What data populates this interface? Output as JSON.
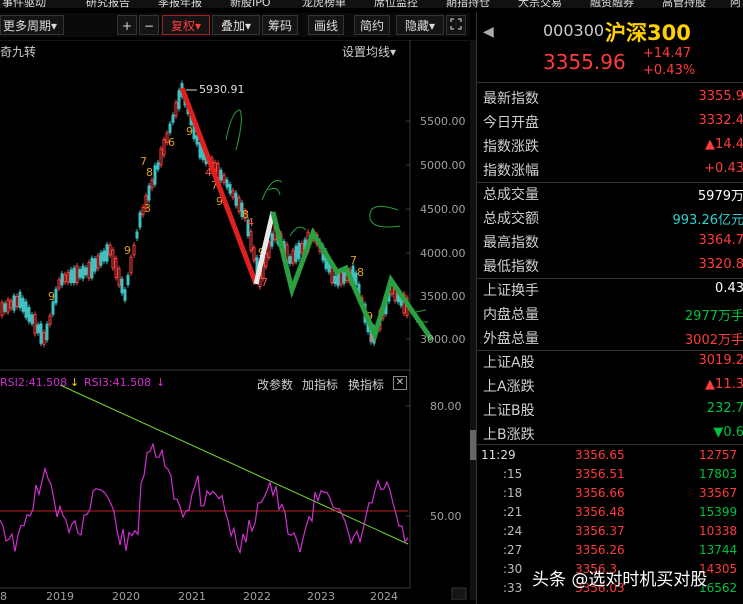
{
  "top_menu": [
    "事件驱动",
    "研究报告",
    "季报年报",
    "新股IPO",
    "龙虎榜单",
    "席位监控",
    "期指持仓",
    "大宗交易",
    "融资融券",
    "高管持股",
    "阿"
  ],
  "toolbar": {
    "period": "更多周期",
    "period_arrow": "▾",
    "plus": "+",
    "minus": "−",
    "adjust": "复权",
    "overlay": "叠加",
    "chips": "筹码",
    "draw": "画线",
    "simple": "简约",
    "hide": "隐藏"
  },
  "main_chart": {
    "indicator_name": "奇九转",
    "set_ma": "设置均线",
    "peak_label": "5930.91",
    "y_ticks": [
      "5500.00",
      "5000.00",
      "4500.00",
      "4000.00",
      "3500.00",
      "3000.00"
    ]
  },
  "rsi_panel": {
    "rsi2": "RSI2:41.508",
    "rsi3": "RSI3:41.508",
    "change_params": "改参数",
    "add_indicator": "加指标",
    "switch_indicator": "换指标",
    "y_ticks": [
      "80.00",
      "50.00"
    ]
  },
  "x_axis": [
    "8",
    "2019",
    "2020",
    "2021",
    "2022",
    "2023",
    "2024"
  ],
  "quote": {
    "code": "000300",
    "name": "沪深300",
    "price": "3355.96",
    "change": "+14.47",
    "change_pct": "+0.43%",
    "colors": {
      "up": "#ff3b3b",
      "down": "#00c040",
      "yellow": "#ffd000",
      "cyan": "#31d0d0"
    }
  },
  "stats": [
    {
      "label": "最新指数",
      "value": "3355.9",
      "color": "#ff3b3b"
    },
    {
      "label": "今日开盘",
      "value": "3332.4",
      "color": "#ff3b3b"
    },
    {
      "label": "指数涨跌",
      "value": "▲14.4",
      "color": "#ff3b3b"
    },
    {
      "label": "指数涨幅",
      "value": "+0.43",
      "color": "#ff3b3b"
    },
    {
      "label": "总成交量",
      "value": "5979万",
      "color": "#ffffff"
    },
    {
      "label": "总成交额",
      "value": "993.26亿元",
      "color": "#31d0d0"
    },
    {
      "label": "最高指数",
      "value": "3364.7",
      "color": "#ff3b3b"
    },
    {
      "label": "最低指数",
      "value": "3320.8",
      "color": "#ff3b3b"
    },
    {
      "label": "上证换手",
      "value": "0.43",
      "color": "#ffffff"
    },
    {
      "label": "内盘总量",
      "value": "2977万手",
      "color": "#00c040"
    },
    {
      "label": "外盘总量",
      "value": "3002万手",
      "color": "#ff3b3b"
    },
    {
      "label": "上证A股",
      "value": "3019.2",
      "color": "#ff3b3b"
    },
    {
      "label": "上A涨跌",
      "value": "▲11.3",
      "color": "#ff3b3b"
    },
    {
      "label": "上证B股",
      "value": "232.7",
      "color": "#00c040"
    },
    {
      "label": "上B涨跌",
      "value": "▼0.6",
      "color": "#00c040"
    }
  ],
  "ticks": [
    {
      "time": "11:29",
      "price": "3356.65",
      "vol": "12757"
    },
    {
      "time": ":15",
      "price": "3356.51",
      "vol": "17803"
    },
    {
      "time": ":18",
      "price": "3356.66",
      "vol": "33567"
    },
    {
      "time": ":21",
      "price": "3356.48",
      "vol": "15399"
    },
    {
      "time": ":24",
      "price": "3356.37",
      "vol": "10338"
    },
    {
      "time": ":27",
      "price": "3356.26",
      "vol": "13744"
    },
    {
      "time": ":30",
      "price": "3356.3",
      "vol": "14305"
    },
    {
      "time": ":33",
      "price": "3356.03",
      "vol": "16562"
    }
  ],
  "watermark": "头条 @选对时机买对股"
}
